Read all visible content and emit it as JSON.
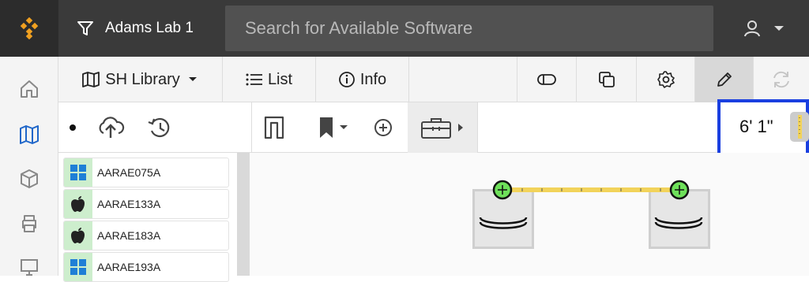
{
  "header": {
    "lab_name": "Adams Lab 1",
    "search_placeholder": "Search for Available Software"
  },
  "toolbar": {
    "library_label": "SH Library",
    "list_label": "List",
    "info_label": "Info"
  },
  "measurement": {
    "value": "6' 1\""
  },
  "software_list": [
    {
      "name": "AARAE075A",
      "os": "windows-icon"
    },
    {
      "name": "AARAE133A",
      "os": "apple-icon"
    },
    {
      "name": "AARAE183A",
      "os": "apple-icon"
    },
    {
      "name": "AARAE193A",
      "os": "windows-icon"
    }
  ],
  "colors": {
    "topbar": "#3a3a3a",
    "accent_highlight": "#1a3fe0",
    "device_marker": "#6ee05a",
    "tape": "#f2d35a",
    "os_icon_bg": "#cdeecd"
  }
}
